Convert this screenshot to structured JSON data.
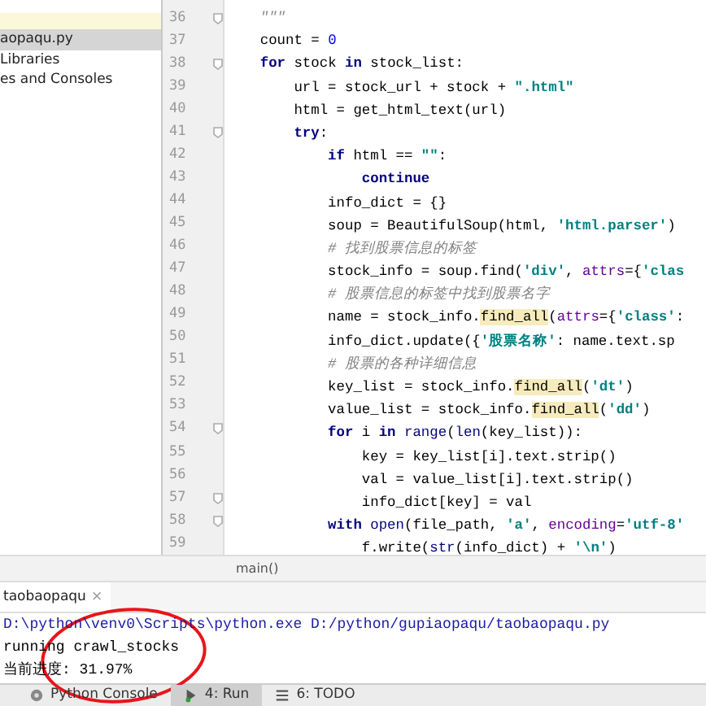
{
  "project": {
    "items": [
      {
        "label": "aopaqu.py",
        "selected": true
      },
      {
        "label": "Libraries",
        "selected": false
      },
      {
        "label": "es and Consoles",
        "selected": false
      }
    ]
  },
  "editor": {
    "lines": [
      {
        "number": "36",
        "fold": true,
        "tokens": [
          {
            "kind": "doc",
            "text": "    \"\"\""
          }
        ]
      },
      {
        "number": "37",
        "fold": false,
        "tokens": [
          {
            "kind": "plain",
            "text": "    count = "
          },
          {
            "kind": "num",
            "text": "0"
          }
        ]
      },
      {
        "number": "38",
        "fold": true,
        "tokens": [
          {
            "kind": "kw",
            "text": "    for"
          },
          {
            "kind": "plain",
            "text": " stock "
          },
          {
            "kind": "kw",
            "text": "in"
          },
          {
            "kind": "plain",
            "text": " stock_list:"
          }
        ]
      },
      {
        "number": "39",
        "fold": false,
        "tokens": [
          {
            "kind": "plain",
            "text": "        url = stock_url + stock + "
          },
          {
            "kind": "str",
            "text": "\".html\""
          }
        ]
      },
      {
        "number": "40",
        "fold": false,
        "tokens": [
          {
            "kind": "plain",
            "text": "        html = get_html_text(url)"
          }
        ]
      },
      {
        "number": "41",
        "fold": true,
        "tokens": [
          {
            "kind": "kw",
            "text": "        try"
          },
          {
            "kind": "plain",
            "text": ":"
          }
        ]
      },
      {
        "number": "42",
        "fold": false,
        "tokens": [
          {
            "kind": "kw",
            "text": "            if"
          },
          {
            "kind": "plain",
            "text": " html == "
          },
          {
            "kind": "str",
            "text": "\"\""
          },
          {
            "kind": "plain",
            "text": ":"
          }
        ]
      },
      {
        "number": "43",
        "fold": false,
        "tokens": [
          {
            "kind": "kw",
            "text": "                continue"
          }
        ]
      },
      {
        "number": "44",
        "fold": false,
        "tokens": [
          {
            "kind": "plain",
            "text": "            info_dict = {}"
          }
        ]
      },
      {
        "number": "45",
        "fold": false,
        "tokens": [
          {
            "kind": "plain",
            "text": "            soup = BeautifulSoup(html, "
          },
          {
            "kind": "str",
            "text": "'html.parser'"
          },
          {
            "kind": "plain",
            "text": ")"
          }
        ]
      },
      {
        "number": "46",
        "fold": false,
        "tokens": [
          {
            "kind": "comment",
            "text": "            # 找到股票信息的标签"
          }
        ]
      },
      {
        "number": "47",
        "fold": false,
        "tokens": [
          {
            "kind": "plain",
            "text": "            stock_info = soup.find("
          },
          {
            "kind": "str",
            "text": "'div'"
          },
          {
            "kind": "plain",
            "text": ", "
          },
          {
            "kind": "param",
            "text": "attrs"
          },
          {
            "kind": "plain",
            "text": "={"
          },
          {
            "kind": "str",
            "text": "'clas"
          }
        ]
      },
      {
        "number": "48",
        "fold": false,
        "tokens": [
          {
            "kind": "comment",
            "text": "            # 股票信息的标签中找到股票名字"
          }
        ]
      },
      {
        "number": "49",
        "fold": false,
        "tokens": [
          {
            "kind": "plain",
            "text": "            name = stock_info."
          },
          {
            "kind": "mark",
            "text": "find_all"
          },
          {
            "kind": "plain",
            "text": "("
          },
          {
            "kind": "param",
            "text": "attrs"
          },
          {
            "kind": "plain",
            "text": "={"
          },
          {
            "kind": "str",
            "text": "'class'"
          },
          {
            "kind": "plain",
            "text": ":"
          }
        ]
      },
      {
        "number": "50",
        "fold": false,
        "tokens": [
          {
            "kind": "plain",
            "text": "            info_dict.update({"
          },
          {
            "kind": "str",
            "text": "'股票名称'"
          },
          {
            "kind": "plain",
            "text": ": name.text.sp"
          }
        ]
      },
      {
        "number": "51",
        "fold": false,
        "tokens": [
          {
            "kind": "comment",
            "text": "            # 股票的各种详细信息"
          }
        ]
      },
      {
        "number": "52",
        "fold": false,
        "tokens": [
          {
            "kind": "plain",
            "text": "            key_list = stock_info."
          },
          {
            "kind": "mark",
            "text": "find_all"
          },
          {
            "kind": "plain",
            "text": "("
          },
          {
            "kind": "str",
            "text": "'dt'"
          },
          {
            "kind": "plain",
            "text": ")"
          }
        ]
      },
      {
        "number": "53",
        "fold": false,
        "tokens": [
          {
            "kind": "plain",
            "text": "            value_list = stock_info."
          },
          {
            "kind": "mark",
            "text": "find_all"
          },
          {
            "kind": "plain",
            "text": "("
          },
          {
            "kind": "str",
            "text": "'dd'"
          },
          {
            "kind": "plain",
            "text": ")"
          }
        ]
      },
      {
        "number": "54",
        "fold": true,
        "tokens": [
          {
            "kind": "kw",
            "text": "            for"
          },
          {
            "kind": "plain",
            "text": " i "
          },
          {
            "kind": "kw",
            "text": "in"
          },
          {
            "kind": "builtin",
            "text": " range"
          },
          {
            "kind": "plain",
            "text": "("
          },
          {
            "kind": "builtin",
            "text": "len"
          },
          {
            "kind": "plain",
            "text": "(key_list)):"
          }
        ]
      },
      {
        "number": "55",
        "fold": false,
        "tokens": [
          {
            "kind": "plain",
            "text": "                key = key_list[i].text.strip()"
          }
        ]
      },
      {
        "number": "56",
        "fold": false,
        "tokens": [
          {
            "kind": "plain",
            "text": "                val = value_list[i].text.strip()"
          }
        ]
      },
      {
        "number": "57",
        "fold": true,
        "tokens": [
          {
            "kind": "plain",
            "text": "                info_dict[key] = val"
          }
        ]
      },
      {
        "number": "58",
        "fold": true,
        "tokens": [
          {
            "kind": "kw",
            "text": "            with"
          },
          {
            "kind": "builtin",
            "text": " open"
          },
          {
            "kind": "plain",
            "text": "(file_path, "
          },
          {
            "kind": "str",
            "text": "'a'"
          },
          {
            "kind": "plain",
            "text": ", "
          },
          {
            "kind": "param",
            "text": "encoding"
          },
          {
            "kind": "plain",
            "text": "="
          },
          {
            "kind": "str",
            "text": "'utf-8'"
          }
        ]
      },
      {
        "number": "59",
        "fold": false,
        "tokens": [
          {
            "kind": "plain",
            "text": "                f.write("
          },
          {
            "kind": "builtin",
            "text": "str"
          },
          {
            "kind": "plain",
            "text": "(info_dict) + "
          },
          {
            "kind": "str",
            "text": "'\\n'"
          },
          {
            "kind": "plain",
            "text": ")"
          }
        ]
      }
    ],
    "breadcrumb": "main()"
  },
  "run_panel": {
    "tab": {
      "label": "taobaopaqu",
      "close": "×"
    },
    "lines": [
      {
        "kind": "command",
        "text": "D:\\python\\venv0\\Scripts\\python.exe D:/python/gupiaopaqu/taobaopaqu.py"
      },
      {
        "kind": "output",
        "text": "running crawl_stocks"
      },
      {
        "kind": "output",
        "text": "当前进度: 31.97%"
      }
    ]
  },
  "tool_tabs": [
    {
      "label": "Python Console",
      "selected": false
    },
    {
      "label": "4: Run",
      "selected": true
    },
    {
      "label": "6: TODO",
      "selected": false
    }
  ]
}
